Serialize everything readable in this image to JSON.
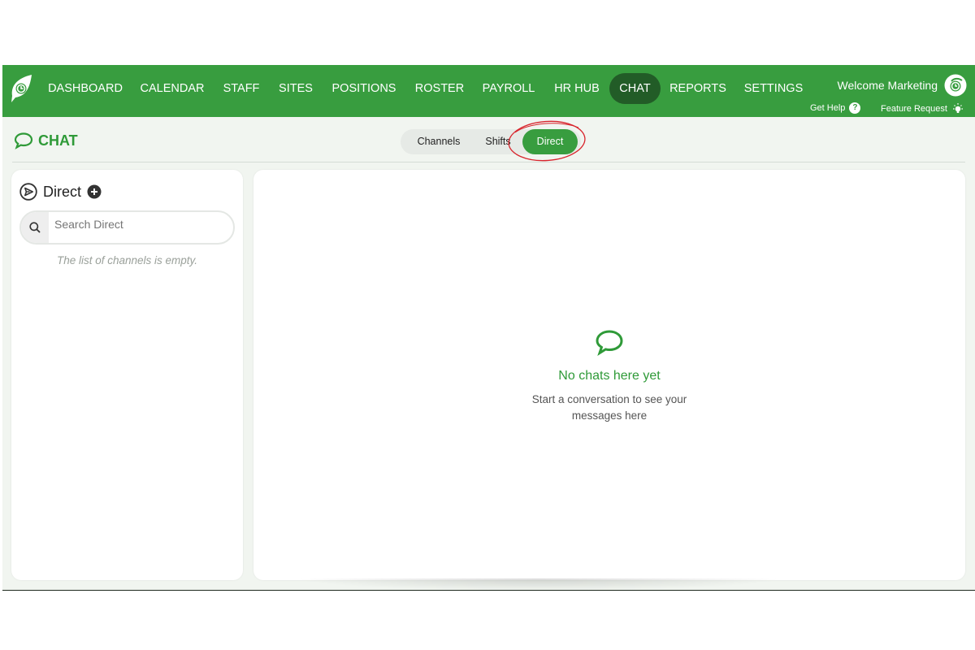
{
  "nav": {
    "items": [
      {
        "label": "DASHBOARD"
      },
      {
        "label": "CALENDAR"
      },
      {
        "label": "STAFF"
      },
      {
        "label": "SITES"
      },
      {
        "label": "POSITIONS"
      },
      {
        "label": "ROSTER"
      },
      {
        "label": "PAYROLL"
      },
      {
        "label": "HR HUB"
      },
      {
        "label": "CHAT",
        "active": true
      },
      {
        "label": "REPORTS"
      },
      {
        "label": "SETTINGS"
      }
    ],
    "welcome": "Welcome Marketing",
    "help_label": "Get Help",
    "feature_label": "Feature Request"
  },
  "page": {
    "title": "CHAT",
    "tabs": [
      {
        "label": "Channels"
      },
      {
        "label": "Shifts"
      },
      {
        "label": "Direct",
        "active": true
      }
    ]
  },
  "sidebar": {
    "title": "Direct",
    "search_placeholder": "Search Direct",
    "empty_text": "The list of channels is empty."
  },
  "main": {
    "empty_title": "No chats here yet",
    "empty_subtitle": "Start a conversation to see your messages here"
  },
  "colors": {
    "brand_green": "#389d3f",
    "active_nav": "#225c27",
    "annotation_red": "#d8242c"
  }
}
